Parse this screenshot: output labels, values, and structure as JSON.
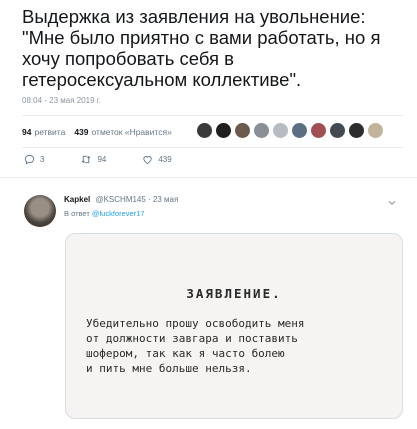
{
  "tweet": {
    "text_lines": [
      "Выдержка из заявления на увольнение:",
      "\"Мне было приятно с вами работать, но я",
      "хочу попробовать себя в",
      "гетеросексуальном коллективе\"."
    ],
    "date": "08:04 - 23 мая 2019 г.",
    "retweets_count": "94",
    "retweets_label": "ретвита",
    "likes_count": "439",
    "likes_label": "отметок «Нравится»",
    "actions": {
      "reply_count": "3",
      "retweet_count": "94",
      "like_count": "439"
    }
  },
  "reply": {
    "name": "Kapkel",
    "meta": "@KSCHM145 · 23 мая",
    "reply_prefix": "В ответ",
    "reply_handle": "@luckforever17"
  },
  "letter": {
    "title": "ЗАЯВЛЕНИЕ.",
    "lines": [
      "Убедительно прошу освободить меня",
      "от должности завгара и поставить",
      "шофером, так как я часто болею",
      "и пить мне больше нельзя."
    ]
  },
  "liker_avatar_colors": [
    "#3a3a3a",
    "#1f1f1f",
    "#6c5a4e",
    "#8a8f96",
    "#b7bcc2",
    "#5c6f82",
    "#a14f52",
    "#444a52",
    "#2d2d2d",
    "#c2b49a"
  ],
  "icons": {
    "reply": "reply-icon",
    "retweet": "retweet-icon",
    "like": "heart-icon",
    "menu": "chevron-down-icon"
  },
  "colors": {
    "link": "#1da1f2",
    "muted": "#657786",
    "text": "#14171a"
  }
}
